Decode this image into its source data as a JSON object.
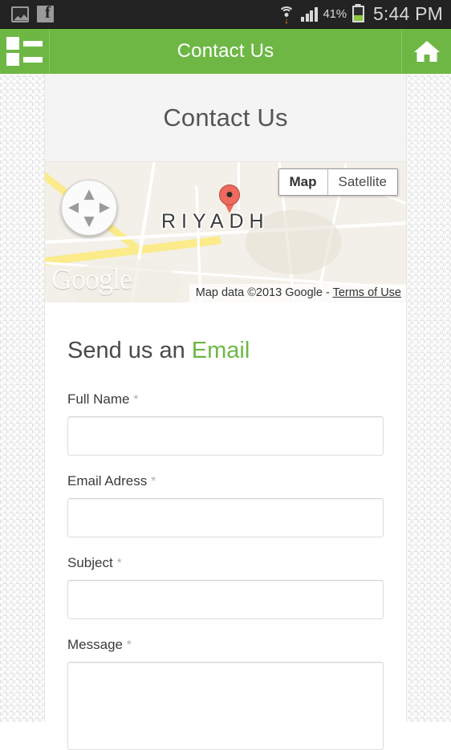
{
  "statusbar": {
    "icons_left": [
      "gallery-icon",
      "facebook-icon"
    ],
    "wifi_icon": "wifi-download-icon",
    "signal_icon": "cellular-signal-icon",
    "battery_percent": "41%",
    "battery_icon": "battery-icon",
    "time": "5:44 PM"
  },
  "appbar": {
    "menu_icon": "list-menu-icon",
    "title": "Contact Us",
    "home_icon": "home-icon",
    "background_color": "#6eb745"
  },
  "page": {
    "heading": "Contact Us"
  },
  "map": {
    "pan_control": {
      "up": "▲",
      "down": "▼",
      "left": "◀",
      "right": "▶"
    },
    "types": [
      {
        "label": "Map",
        "active": true
      },
      {
        "label": "Satellite",
        "active": false
      }
    ],
    "city_label": "RIYADH",
    "marker": "map-pin-marker",
    "watermark": "Google",
    "attribution_text": "Map data ©2013 Google - ",
    "attribution_link": "Terms of Use"
  },
  "form": {
    "heading_prefix": "Send us an ",
    "heading_accent": "Email",
    "accent_color": "#6eb745",
    "required_mark": "*",
    "fields": [
      {
        "label": "Full Name",
        "value": "",
        "placeholder": "",
        "type": "text"
      },
      {
        "label": "Email Adress",
        "value": "",
        "placeholder": "",
        "type": "text"
      },
      {
        "label": "Subject",
        "value": "",
        "placeholder": "",
        "type": "text"
      },
      {
        "label": "Message",
        "value": "",
        "placeholder": "",
        "type": "textarea"
      }
    ]
  }
}
